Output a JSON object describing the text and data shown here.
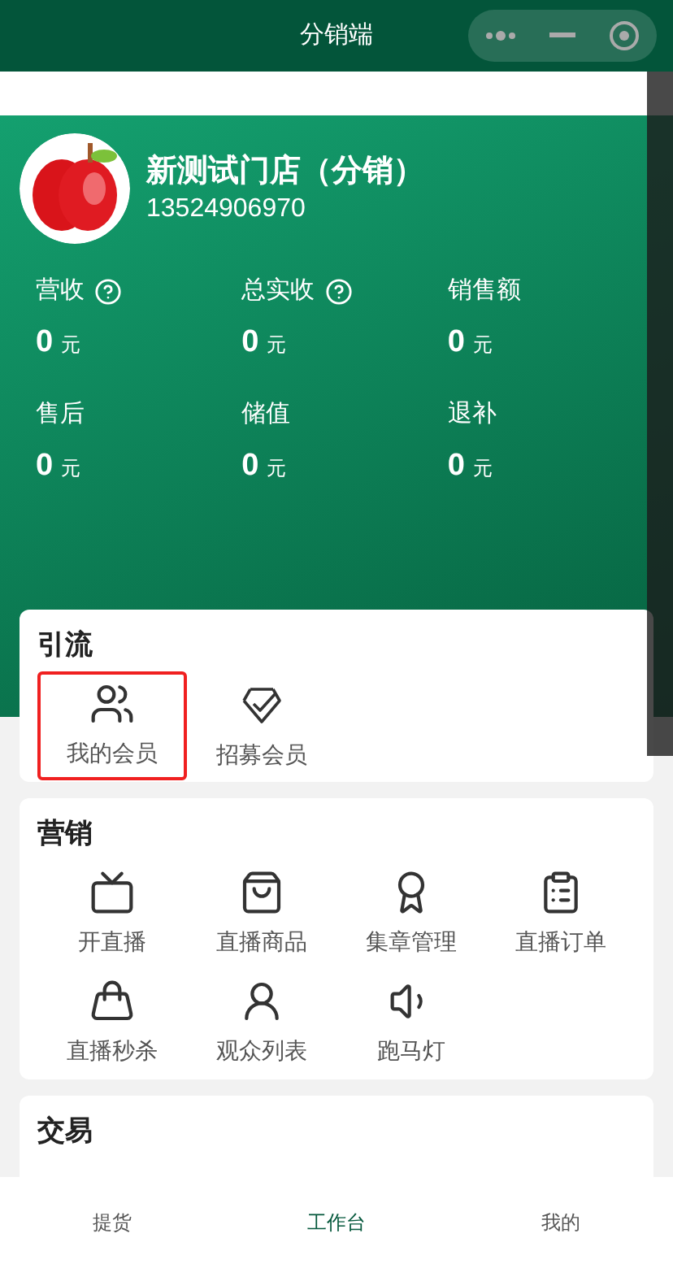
{
  "title_bar": {
    "title": "分销端"
  },
  "store": {
    "name": "新测试门店（分销）",
    "phone": "13524906970"
  },
  "stats": [
    {
      "label": "营收",
      "help": true,
      "value": "0",
      "unit": "元"
    },
    {
      "label": "总实收",
      "help": true,
      "value": "0",
      "unit": "元"
    },
    {
      "label": "销售额",
      "help": false,
      "value": "0",
      "unit": "元"
    },
    {
      "label": "售后",
      "help": false,
      "value": "0",
      "unit": "元"
    },
    {
      "label": "储值",
      "help": false,
      "value": "0",
      "unit": "元"
    },
    {
      "label": "退补",
      "help": false,
      "value": "0",
      "unit": "元"
    }
  ],
  "sections": [
    {
      "title": "引流",
      "items": [
        {
          "label": "我的会员",
          "highlighted": true
        },
        {
          "label": "招募会员",
          "highlighted": false
        }
      ]
    },
    {
      "title": "营销",
      "items": [
        {
          "label": "开直播",
          "highlighted": false
        },
        {
          "label": "直播商品",
          "highlighted": false
        },
        {
          "label": "集章管理",
          "highlighted": false
        },
        {
          "label": "直播订单",
          "highlighted": false
        },
        {
          "label": "直播秒杀",
          "highlighted": false
        },
        {
          "label": "观众列表",
          "highlighted": false
        },
        {
          "label": "跑马灯",
          "highlighted": false
        }
      ]
    },
    {
      "title": "交易"
    }
  ],
  "tab_bar": [
    {
      "label": "提货",
      "selected": false
    },
    {
      "label": "工作台",
      "selected": true
    },
    {
      "label": "我的",
      "selected": false
    }
  ]
}
